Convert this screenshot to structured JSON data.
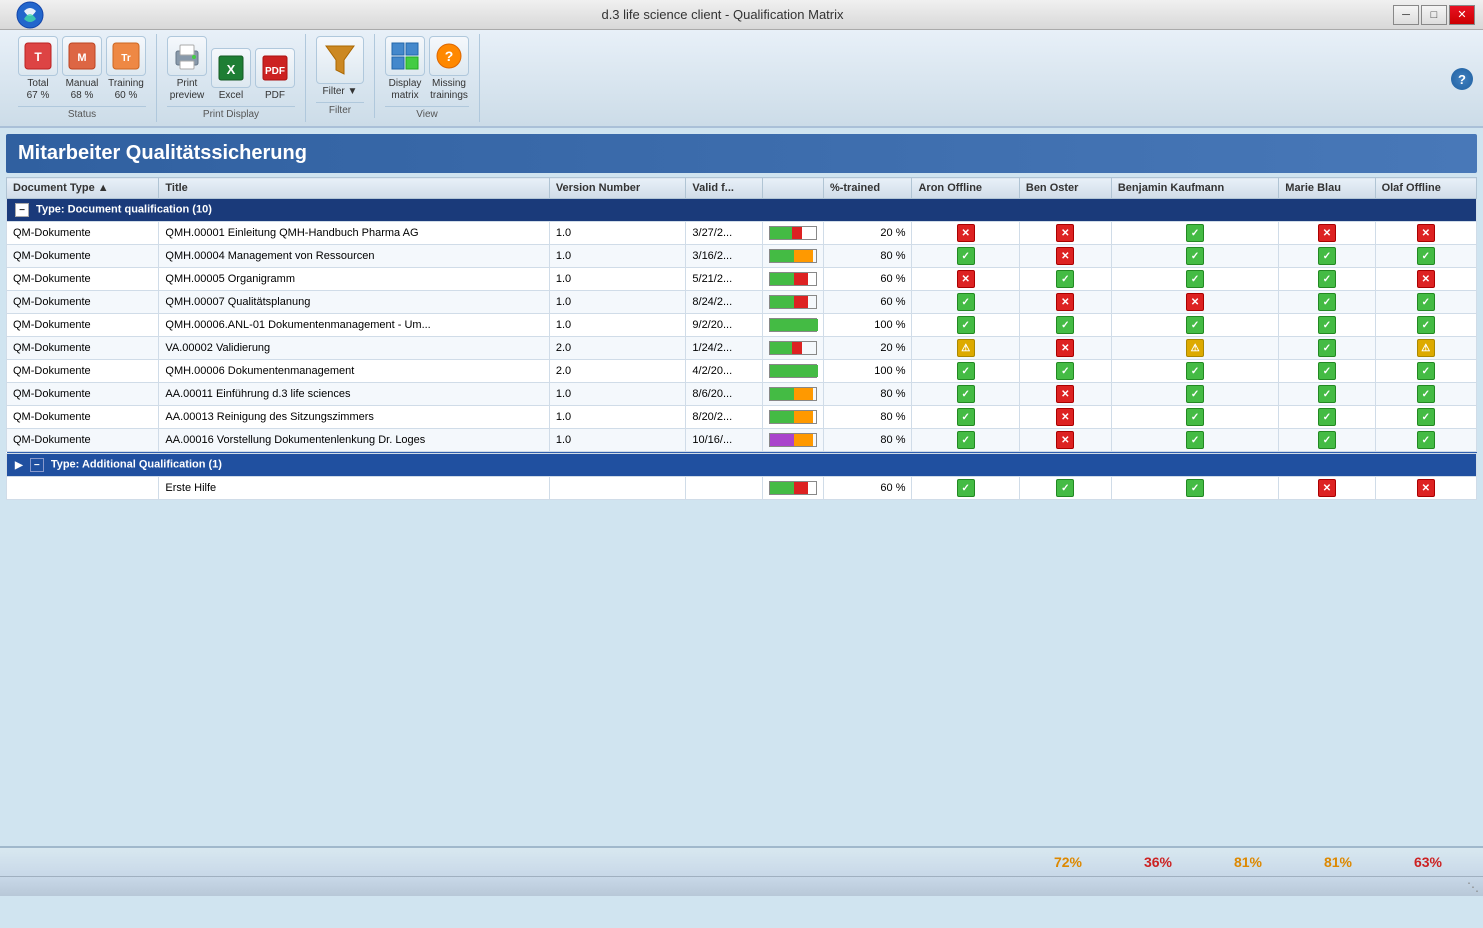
{
  "window": {
    "title": "d.3 life science client - Qualification Matrix"
  },
  "titlebar": {
    "minimize": "─",
    "restore": "□",
    "close": "✕"
  },
  "toolbar": {
    "status_group_label": "Status",
    "print_display_label": "Print Display",
    "filter_label": "Filter",
    "view_label": "View",
    "buttons": {
      "total": {
        "label": "Total\n67 %",
        "line1": "Total",
        "line2": "67 %"
      },
      "manual": {
        "label": "Manual\n68 %",
        "line1": "Manual",
        "line2": "68 %"
      },
      "training": {
        "label": "Training\n60 %",
        "line1": "Training",
        "line2": "60 %"
      },
      "print_preview": {
        "label": "Print\npreview",
        "line1": "Print",
        "line2": "preview"
      },
      "excel": {
        "label": "Excel"
      },
      "pdf": {
        "label": "PDF"
      },
      "filter": {
        "label": "Filter"
      },
      "display_matrix": {
        "label": "Display\nmatrix",
        "line1": "Display",
        "line2": "matrix"
      },
      "missing_trainings": {
        "label": "Missing\ntrainings",
        "line1": "Missing",
        "line2": "trainings"
      }
    }
  },
  "section_title": "Mitarbeiter Qualitätssicherung",
  "table": {
    "columns": [
      "Document Type ▲",
      "Title",
      "Version Number",
      "Valid f...",
      "",
      "%-trained",
      "Aron Offline",
      "Ben Oster",
      "Benjamin Kaufmann",
      "Marie Blau",
      "Olaf Offline"
    ],
    "group1": {
      "label": "Type: Document qualification (10)",
      "rows": [
        {
          "type": "QM-Dokumente",
          "title": "QMH.00001 Einleitung QMH-Handbuch Pharma AG",
          "version": "1.0",
          "valid": "3/27/2...",
          "bar_pct": 20,
          "bar_color": "red",
          "pct_label": "20 %",
          "aron": "red",
          "ben": "red",
          "benjamin": "green",
          "marie": "red",
          "olaf": "red"
        },
        {
          "type": "QM-Dokumente",
          "title": "QMH.00004 Management von Ressourcen",
          "version": "1.0",
          "valid": "3/16/2...",
          "bar_pct": 80,
          "bar_color": "orange",
          "pct_label": "80 %",
          "aron": "green",
          "ben": "red",
          "benjamin": "green",
          "marie": "green",
          "olaf": "green"
        },
        {
          "type": "QM-Dokumente",
          "title": "QMH.00005 Organigramm",
          "version": "1.0",
          "valid": "5/21/2...",
          "bar_pct": 60,
          "bar_color": "red",
          "pct_label": "60 %",
          "aron": "red",
          "ben": "green",
          "benjamin": "green",
          "marie": "green",
          "olaf": "red"
        },
        {
          "type": "QM-Dokumente",
          "title": "QMH.00007 Qualitätsplanung",
          "version": "1.0",
          "valid": "8/24/2...",
          "bar_pct": 60,
          "bar_color": "red",
          "pct_label": "60 %",
          "aron": "green",
          "ben": "red",
          "benjamin": "red",
          "marie": "green",
          "olaf": "green"
        },
        {
          "type": "QM-Dokumente",
          "title": "QMH.00006.ANL-01 Dokumentenmanagement - Um...",
          "version": "1.0",
          "valid": "9/2/20...",
          "bar_pct": 100,
          "bar_color": "green",
          "pct_label": "100 %",
          "aron": "green",
          "ben": "green",
          "benjamin": "green",
          "marie": "green",
          "olaf": "green"
        },
        {
          "type": "QM-Dokumente",
          "title": "VA.00002 Validierung",
          "version": "2.0",
          "valid": "1/24/2...",
          "bar_pct": 20,
          "bar_color": "red",
          "pct_label": "20 %",
          "aron": "yellow",
          "ben": "red",
          "benjamin": "yellow",
          "marie": "green",
          "olaf": "yellow"
        },
        {
          "type": "QM-Dokumente",
          "title": "QMH.00006 Dokumentenmanagement",
          "version": "2.0",
          "valid": "4/2/20...",
          "bar_pct": 100,
          "bar_color": "green",
          "pct_label": "100 %",
          "aron": "green",
          "ben": "green",
          "benjamin": "green",
          "marie": "green",
          "olaf": "green"
        },
        {
          "type": "QM-Dokumente",
          "title": "AA.00011 Einführung d.3 life sciences",
          "version": "1.0",
          "valid": "8/6/20...",
          "bar_pct": 80,
          "bar_color": "orange",
          "pct_label": "80 %",
          "aron": "green",
          "ben": "red",
          "benjamin": "green",
          "marie": "green",
          "olaf": "green"
        },
        {
          "type": "QM-Dokumente",
          "title": "AA.00013 Reinigung des Sitzungszimmers",
          "version": "1.0",
          "valid": "8/20/2...",
          "bar_pct": 80,
          "bar_color": "orange",
          "pct_label": "80 %",
          "aron": "green",
          "ben": "red",
          "benjamin": "green",
          "marie": "green",
          "olaf": "green"
        },
        {
          "type": "QM-Dokumente",
          "title": "AA.00016 Vorstellung Dokumentenlenkung Dr. Loges",
          "version": "1.0",
          "valid": "10/16/...",
          "bar_pct": 80,
          "bar_color": "orange",
          "pct_label": "80 %",
          "bar_special": "purple",
          "aron": "green",
          "ben": "red",
          "benjamin": "green",
          "marie": "green",
          "olaf": "green"
        }
      ]
    },
    "group2": {
      "label": "Type: Additional Qualification (1)",
      "rows": [
        {
          "type": "",
          "title": "Erste Hilfe",
          "version": "",
          "valid": "",
          "bar_pct": 60,
          "bar_color": "red",
          "pct_label": "60 %",
          "aron": "green",
          "ben": "green",
          "benjamin": "green",
          "marie": "red",
          "olaf": "red"
        }
      ]
    }
  },
  "footer": {
    "aron_pct": "72%",
    "ben_pct": "36%",
    "benjamin_pct": "81%",
    "marie_pct": "81%",
    "olaf_pct": "63%",
    "aron_color": "orange",
    "ben_color": "red",
    "benjamin_color": "orange",
    "marie_color": "orange",
    "olaf_color": "red"
  }
}
